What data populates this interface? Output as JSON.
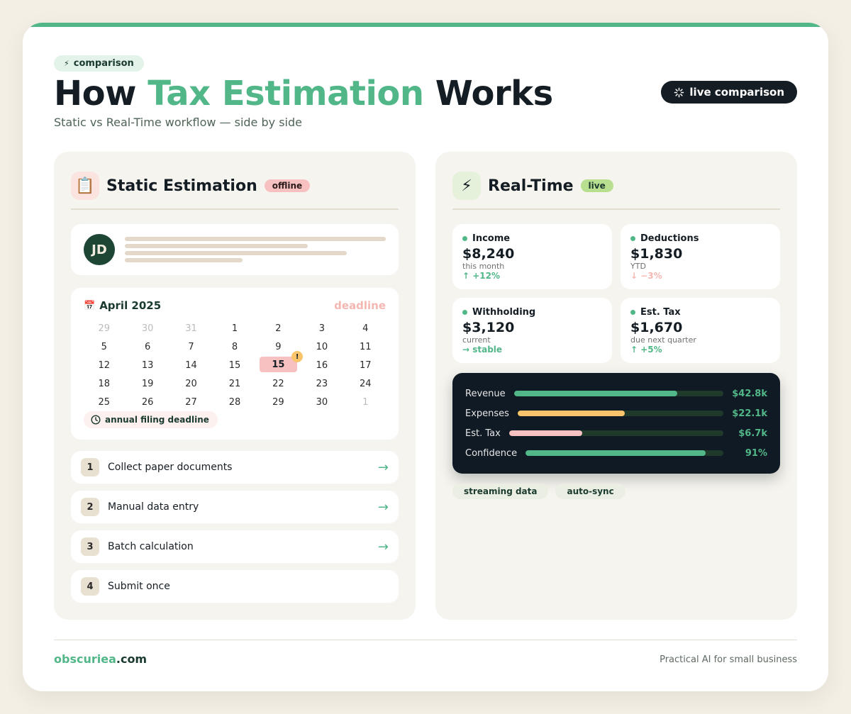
{
  "header": {
    "chip_label": "comparison",
    "title_pre": "How",
    "title_accent": "Tax Estimation",
    "title_post": "Works",
    "subtitle": "Static vs Real-Time workflow — side by side",
    "live_label": "live comparison"
  },
  "left_panel": {
    "icon": "clipboard-icon",
    "title": "Static Estimation",
    "tag": "offline",
    "profile": {
      "initials": "JD"
    },
    "calendar": {
      "month": "April 2025",
      "deadline_label": "deadline",
      "days": [
        {
          "n": "29",
          "muted": true
        },
        {
          "n": "30",
          "muted": true
        },
        {
          "n": "31",
          "muted": true
        },
        {
          "n": "1"
        },
        {
          "n": "2"
        },
        {
          "n": "3"
        },
        {
          "n": "4"
        },
        {
          "n": "5"
        },
        {
          "n": "6"
        },
        {
          "n": "7"
        },
        {
          "n": "8"
        },
        {
          "n": "9"
        },
        {
          "n": "10"
        },
        {
          "n": "11"
        },
        {
          "n": "12"
        },
        {
          "n": "13"
        },
        {
          "n": "14"
        },
        {
          "n": "15"
        },
        {
          "n": "15",
          "highlight": true,
          "badge": "!"
        },
        {
          "n": "16"
        },
        {
          "n": "17"
        },
        {
          "n": "18"
        },
        {
          "n": "19"
        },
        {
          "n": "20"
        },
        {
          "n": "21"
        },
        {
          "n": "22"
        },
        {
          "n": "23"
        },
        {
          "n": "24"
        },
        {
          "n": "25"
        },
        {
          "n": "26"
        },
        {
          "n": "27"
        },
        {
          "n": "28"
        },
        {
          "n": "29"
        },
        {
          "n": "30"
        },
        {
          "n": "1",
          "muted": true
        }
      ],
      "footer": "annual filing deadline"
    },
    "steps": [
      {
        "num": "1",
        "label": "Collect paper documents",
        "arrow": "→"
      },
      {
        "num": "2",
        "label": "Manual data entry",
        "arrow": "→"
      },
      {
        "num": "3",
        "label": "Batch calculation",
        "arrow": "→"
      },
      {
        "num": "4",
        "label": "Submit once",
        "arrow": ""
      }
    ]
  },
  "right_panel": {
    "icon": "lightning-icon",
    "title": "Real-Time",
    "tag": "live",
    "metrics": [
      {
        "label": "Income",
        "value": "$8,240",
        "sub": "this month",
        "delta": "↑ +12%",
        "trend": "up"
      },
      {
        "label": "Deductions",
        "value": "$1,830",
        "sub": "YTD",
        "delta": "↓ −3%",
        "trend": "down"
      },
      {
        "label": "Withholding",
        "value": "$3,120",
        "sub": "current",
        "delta": "→ stable",
        "trend": "up"
      },
      {
        "label": "Est. Tax",
        "value": "$1,670",
        "sub": "due next quarter",
        "delta": "↑ +5%",
        "trend": "up"
      }
    ],
    "bars": [
      {
        "label": "Revenue",
        "value": "$42.8k",
        "fill": 0.78,
        "color": "#52b788"
      },
      {
        "label": "Expenses",
        "value": "$22.1k",
        "fill": 0.52,
        "color": "#f9c46b"
      },
      {
        "label": "Est. Tax",
        "value": "$6.7k",
        "fill": 0.34,
        "color": "#f7c1c1"
      },
      {
        "label": "Confidence",
        "value": "91%",
        "fill": 0.91,
        "color": "#52b788"
      }
    ],
    "tags": [
      "streaming data",
      "auto-sync"
    ]
  },
  "footer": {
    "brand_name": "obscuriea",
    "brand_tld": ".com",
    "tagline": "Practical AI for small business"
  },
  "colors": {
    "accent": "#52b788",
    "dark": "#141c24",
    "warning": "#f9c46b",
    "alert": "#f7c1c1"
  }
}
